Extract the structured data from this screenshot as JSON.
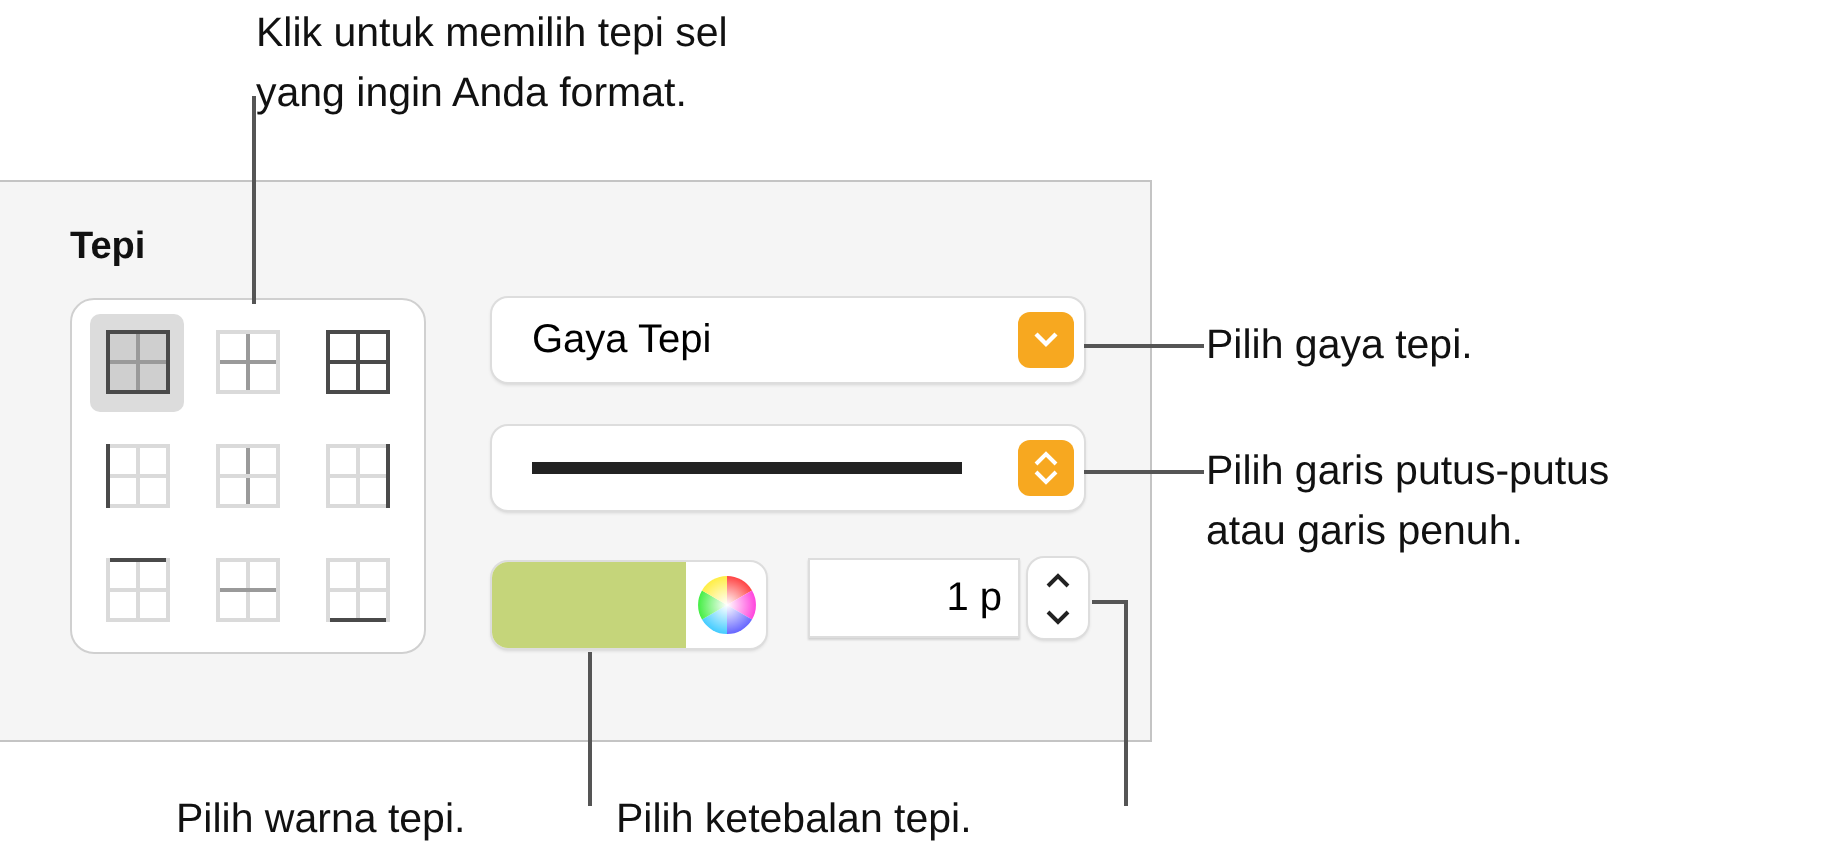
{
  "panel": {
    "title": "Tepi",
    "border_buttons": [
      {
        "kind": "outer",
        "selected": true
      },
      {
        "kind": "inner",
        "selected": false
      },
      {
        "kind": "all",
        "selected": false
      },
      {
        "kind": "left",
        "selected": false
      },
      {
        "kind": "vertical",
        "selected": false
      },
      {
        "kind": "right",
        "selected": false
      },
      {
        "kind": "top",
        "selected": false
      },
      {
        "kind": "horizontal",
        "selected": false
      },
      {
        "kind": "bottom",
        "selected": false
      }
    ],
    "style_dropdown": {
      "value": "Gaya Tepi"
    },
    "line_dropdown": {
      "kind": "solid"
    },
    "color_well": {
      "color": "#c5d57a"
    },
    "thickness": {
      "value": "1 p"
    }
  },
  "callouts": [
    {
      "kind": "grid",
      "lines": [
        "Klik untuk memilih tepi sel",
        "yang ingin Anda format."
      ]
    },
    {
      "kind": "style",
      "lines": [
        "Pilih gaya tepi."
      ]
    },
    {
      "kind": "line",
      "lines": [
        "Pilih garis putus-putus",
        "atau garis penuh."
      ]
    },
    {
      "kind": "color",
      "lines": [
        "Pilih warna tepi."
      ]
    },
    {
      "kind": "thickness",
      "lines": [
        "Pilih ketebalan tepi."
      ]
    }
  ]
}
